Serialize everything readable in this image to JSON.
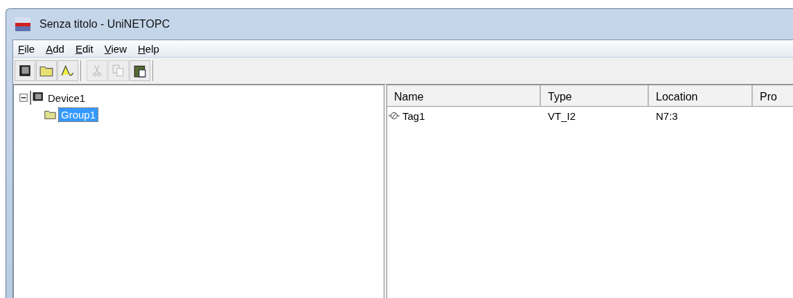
{
  "window": {
    "title": "Senza titolo - UniNETOPC"
  },
  "menu": [
    "File",
    "Add",
    "Edit",
    "View",
    "Help"
  ],
  "toolbar": [
    {
      "kind": "device",
      "disabled": false
    },
    {
      "kind": "folder",
      "disabled": false
    },
    {
      "kind": "wave",
      "disabled": false
    },
    {
      "kind": "cut",
      "disabled": true
    },
    {
      "kind": "copy",
      "disabled": true
    },
    {
      "kind": "paste",
      "disabled": false
    }
  ],
  "tree": [
    {
      "label": "Device1",
      "kind": "device",
      "expanded": true,
      "selected": false,
      "children": [
        {
          "label": "Group1",
          "kind": "folder",
          "selected": true
        }
      ]
    }
  ],
  "table": {
    "columns": [
      "Name",
      "Type",
      "Location",
      "Pro"
    ],
    "rows": [
      [
        "Tag1",
        "VT_I2",
        "N7:3"
      ]
    ]
  }
}
